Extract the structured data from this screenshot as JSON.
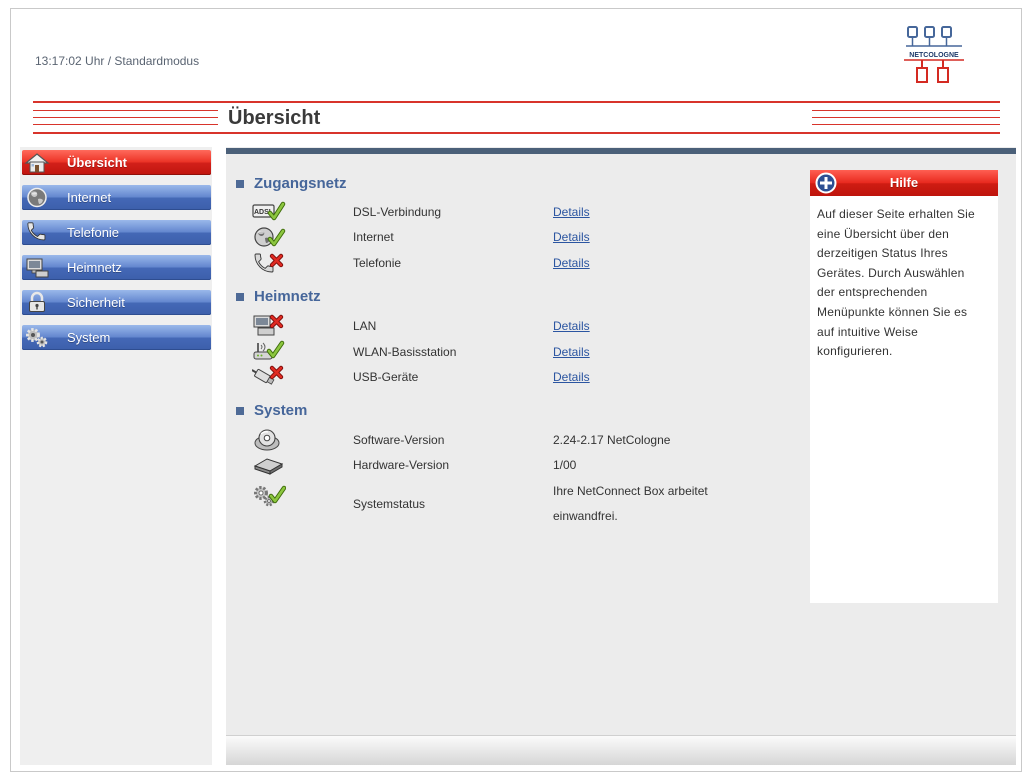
{
  "header": {
    "status_text": "13:17:02 Uhr / Standardmodus",
    "logo_text": "NETCOLOGNE"
  },
  "page_title": "Übersicht",
  "nav": [
    {
      "label": "Übersicht",
      "icon": "home-icon",
      "active": true
    },
    {
      "label": "Internet",
      "icon": "globe-icon",
      "active": false
    },
    {
      "label": "Telefonie",
      "icon": "phone-icon",
      "active": false
    },
    {
      "label": "Heimnetz",
      "icon": "network-icon",
      "active": false
    },
    {
      "label": "Sicherheit",
      "icon": "padlock-icon",
      "active": false
    },
    {
      "label": "System",
      "icon": "gears-icon",
      "active": false
    }
  ],
  "sections": [
    {
      "title": "Zugangsnetz",
      "rows": [
        {
          "label": "DSL-Verbindung",
          "icon": "adsl-icon",
          "icon_text": "ADSL",
          "status_icon": "check-icon",
          "value": "Details"
        },
        {
          "label": "Internet",
          "icon": "globe-icon",
          "status_icon": "check-icon",
          "value": "Details"
        },
        {
          "label": "Telefonie",
          "icon": "phone-icon",
          "status_icon": "cross-icon",
          "value": "Details"
        }
      ]
    },
    {
      "title": "Heimnetz",
      "rows": [
        {
          "label": "LAN",
          "icon": "computer-icon",
          "status_icon": "cross-icon",
          "value": "Details"
        },
        {
          "label": "WLAN-Basisstation",
          "icon": "wlan-router-icon",
          "status_icon": "check-icon",
          "value": "Details"
        },
        {
          "label": "USB-Geräte",
          "icon": "usb-plug-icon",
          "status_icon": "cross-icon",
          "value": "Details"
        }
      ]
    },
    {
      "title": "System",
      "rows": [
        {
          "label": "Software-Version",
          "icon": "disc-icon",
          "value": "2.24-2.17 NetCologne"
        },
        {
          "label": "Hardware-Version",
          "icon": "router-icon",
          "value": "1/00"
        },
        {
          "label": "Systemstatus",
          "icon": "gears-icon",
          "status_icon": "check-icon",
          "value": "Ihre NetConnect Box arbeitet einwandfrei."
        }
      ]
    }
  ],
  "help": {
    "title": "Hilfe",
    "icon": "plus-circle-icon",
    "lines": [
      "Auf dieser Seite erhalten Sie",
      "eine Übersicht über den",
      "derzeitigen Status Ihres",
      "Gerätes. Durch Auswählen",
      "der entsprechenden",
      "Menüpunkte können Sie es",
      "auf intuitive Weise",
      "konfigurieren."
    ]
  },
  "colors": {
    "accent_red": "#d8342b",
    "nav_blue": "#6487cf",
    "heading_blue": "#46669a",
    "link_blue": "#2b55a1",
    "check_green": "#8cc63f",
    "error_red": "#d8201b"
  }
}
